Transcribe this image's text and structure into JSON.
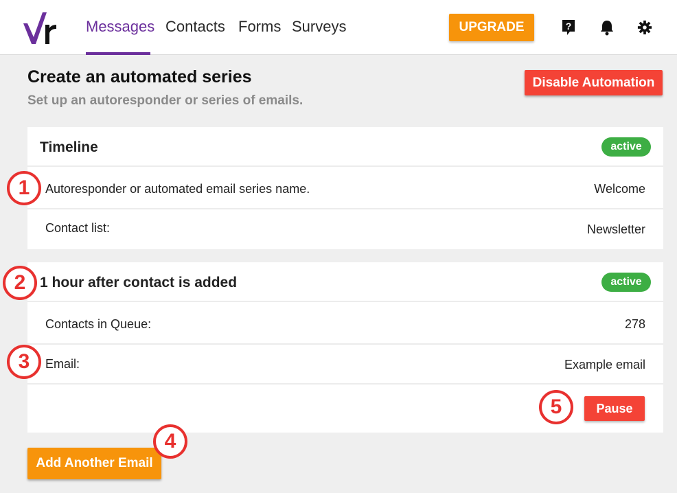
{
  "nav": {
    "items": [
      {
        "label": "Messages",
        "active": true
      },
      {
        "label": "Contacts",
        "active": false
      },
      {
        "label": "Forms",
        "active": false
      },
      {
        "label": "Surveys",
        "active": false
      }
    ],
    "upgrade_label": "UPGRADE",
    "icons": [
      "help-icon",
      "bell-icon",
      "gear-icon"
    ],
    "accent_color": "#6b2f9c"
  },
  "header": {
    "title": "Create an automated series",
    "subtitle": "Set up an autoresponder or series of emails.",
    "disable_label": "Disable Automation"
  },
  "timeline": {
    "title": "Timeline",
    "status": "active",
    "name_label": "Autoresponder or automated email series name.",
    "name_value": "Welcome",
    "list_label": "Contact list:",
    "list_value": "Newsletter"
  },
  "step": {
    "title": "1 hour after contact is added",
    "status": "active",
    "queue_label": "Contacts in Queue:",
    "queue_value": "278",
    "email_label": "Email:",
    "email_value": "Example email",
    "pause_label": "Pause"
  },
  "add_email_label": "Add Another Email",
  "callouts": [
    "1",
    "2",
    "3",
    "4",
    "5"
  ],
  "colors": {
    "orange": "#f7940b",
    "red": "#f44336",
    "green": "#3dae44",
    "callout_red": "#e8312f"
  }
}
